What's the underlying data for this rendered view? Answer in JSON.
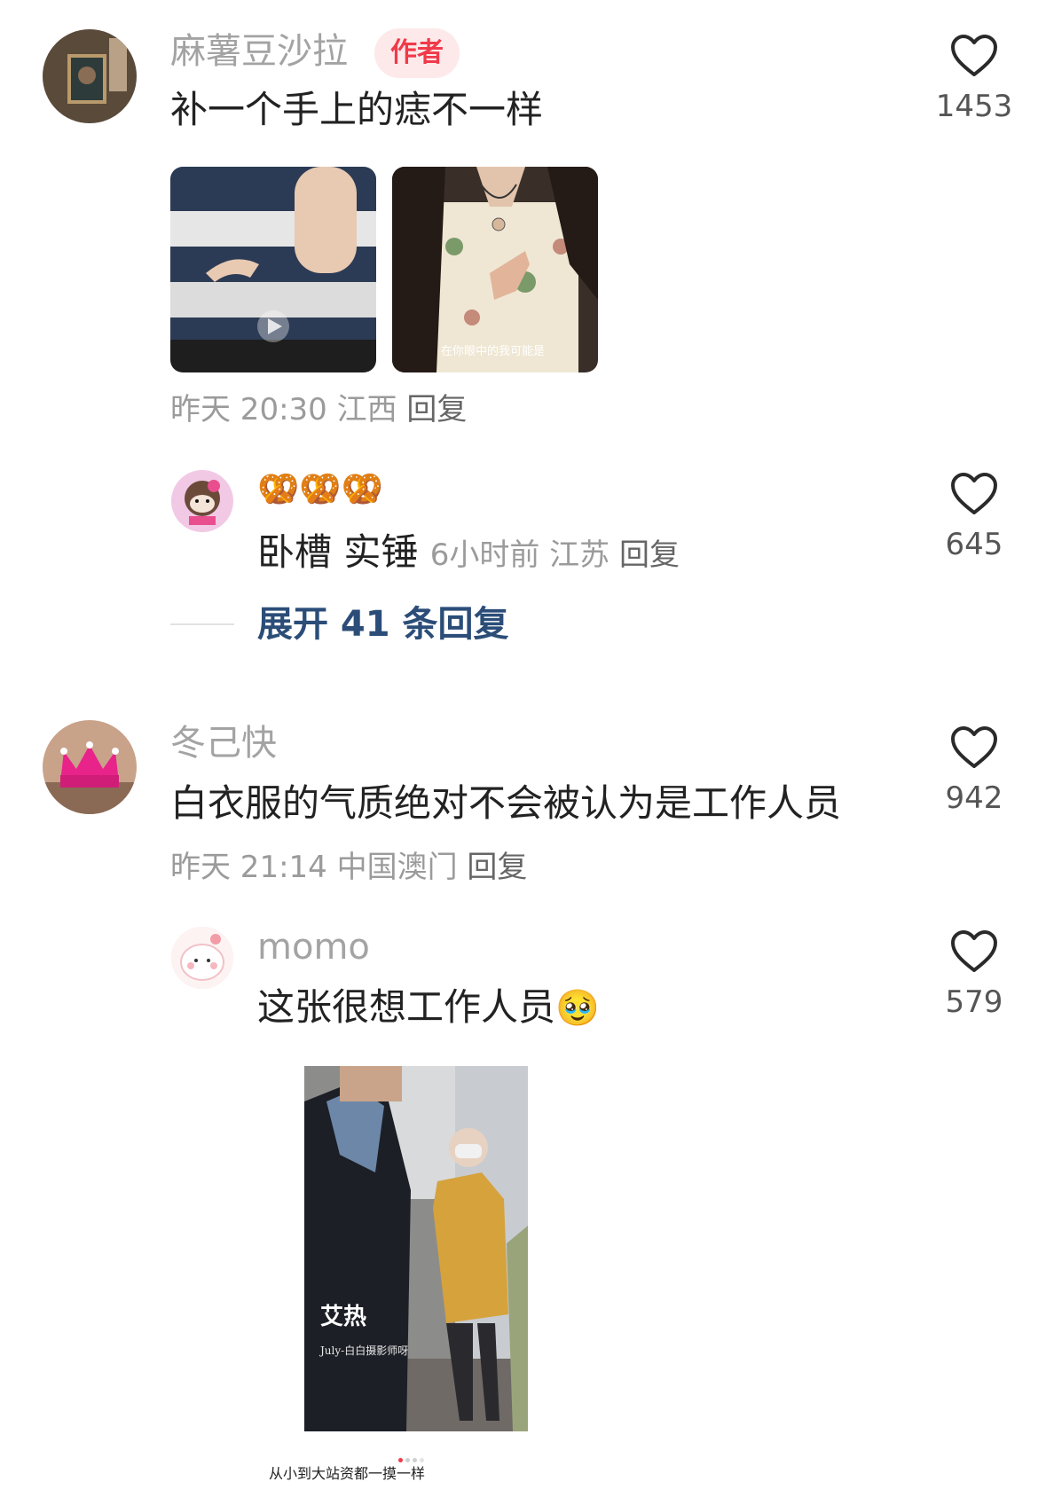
{
  "comments": [
    {
      "username": "麻薯豆沙拉",
      "author_badge": "作者",
      "text": "补一个手上的痣不一样",
      "time": "昨天 20:30",
      "location": "江西",
      "reply_label": "回复",
      "likes": "1453",
      "image_captions": [
        "在你眼中的我可能是"
      ],
      "replies": [
        {
          "username": "🥨🥨🥨",
          "text": "卧槽 实锤",
          "time": "6小时前",
          "location": "江苏",
          "reply_label": "回复",
          "likes": "645"
        }
      ],
      "expand_label": "展开 41 条回复"
    },
    {
      "username": "冬己快",
      "text": "白衣服的气质绝对不会被认为是工作人员",
      "time": "昨天 21:14",
      "location": "中国澳门",
      "reply_label": "回复",
      "likes": "942",
      "replies": [
        {
          "username": "momo",
          "text": "这张很想工作人员",
          "emoji": "🥹",
          "likes": "579",
          "image_overlay_title": "艾热",
          "image_overlay_sub": "July-白白摄影师呀",
          "image_caption": "从小到大站资都一摸一样"
        }
      ]
    }
  ],
  "colors": {
    "username": "#a3a3a3",
    "author_badge_bg": "#fde9ea",
    "author_badge_text": "#f03a4a",
    "expand_link": "#2b4d78",
    "carousel_active_dot": "#f03a4a"
  },
  "icons": [
    "heart-outline-icon",
    "play-icon"
  ]
}
